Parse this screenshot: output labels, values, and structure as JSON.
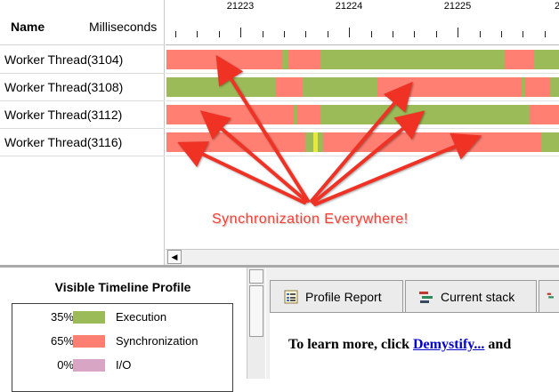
{
  "columns": {
    "name": "Name",
    "milliseconds": "Milliseconds"
  },
  "ruler": {
    "labels": [
      "21223",
      "21224",
      "21225",
      "2"
    ]
  },
  "threads": [
    {
      "label": "Worker Thread(3104)",
      "segments": [
        [
          "s",
          130
        ],
        [
          "e",
          7
        ],
        [
          "s",
          36
        ],
        [
          "e",
          207
        ],
        [
          "s",
          33
        ],
        [
          "e",
          28
        ]
      ]
    },
    {
      "label": "Worker Thread(3108)",
      "segments": [
        [
          "e",
          123
        ],
        [
          "s",
          30
        ],
        [
          "e",
          84
        ],
        [
          "s",
          162
        ],
        [
          "e",
          4
        ],
        [
          "s",
          28
        ],
        [
          "e",
          10
        ]
      ]
    },
    {
      "label": "Worker Thread(3112)",
      "segments": [
        [
          "s",
          143
        ],
        [
          "e",
          4
        ],
        [
          "s",
          26
        ],
        [
          "e",
          235
        ],
        [
          "s",
          33
        ]
      ]
    },
    {
      "label": "Worker Thread(3116)",
      "segments": [
        [
          "s",
          156
        ],
        [
          "e",
          9
        ],
        [
          "y",
          5
        ],
        [
          "e",
          6
        ],
        [
          "s",
          245
        ],
        [
          "e",
          20
        ]
      ]
    }
  ],
  "annotation": "Synchronization Everywhere!",
  "profile": {
    "title": "Visible Timeline Profile",
    "rows": [
      {
        "percent": "35%",
        "label": "Execution",
        "color": "#9bbb59"
      },
      {
        "percent": "65%",
        "label": "Synchronization",
        "color": "#ff7f72"
      },
      {
        "percent": "0%",
        "label": "I/O",
        "color": "#d9a5c4"
      }
    ]
  },
  "tabs": {
    "profile_report": "Profile Report",
    "current_stack": "Current stack"
  },
  "report": {
    "learn_prefix": "To learn more, click ",
    "link": "Demystify...",
    "learn_suffix": " and"
  },
  "colors": {
    "execution": "#9bbb59",
    "synchronization": "#ff7f72",
    "marker": "#e8e83a",
    "arrow": "#f03225"
  },
  "icons": {
    "scroll_left": "triangle-left",
    "profile_report": "report-icon",
    "current_stack": "stack-icon"
  }
}
